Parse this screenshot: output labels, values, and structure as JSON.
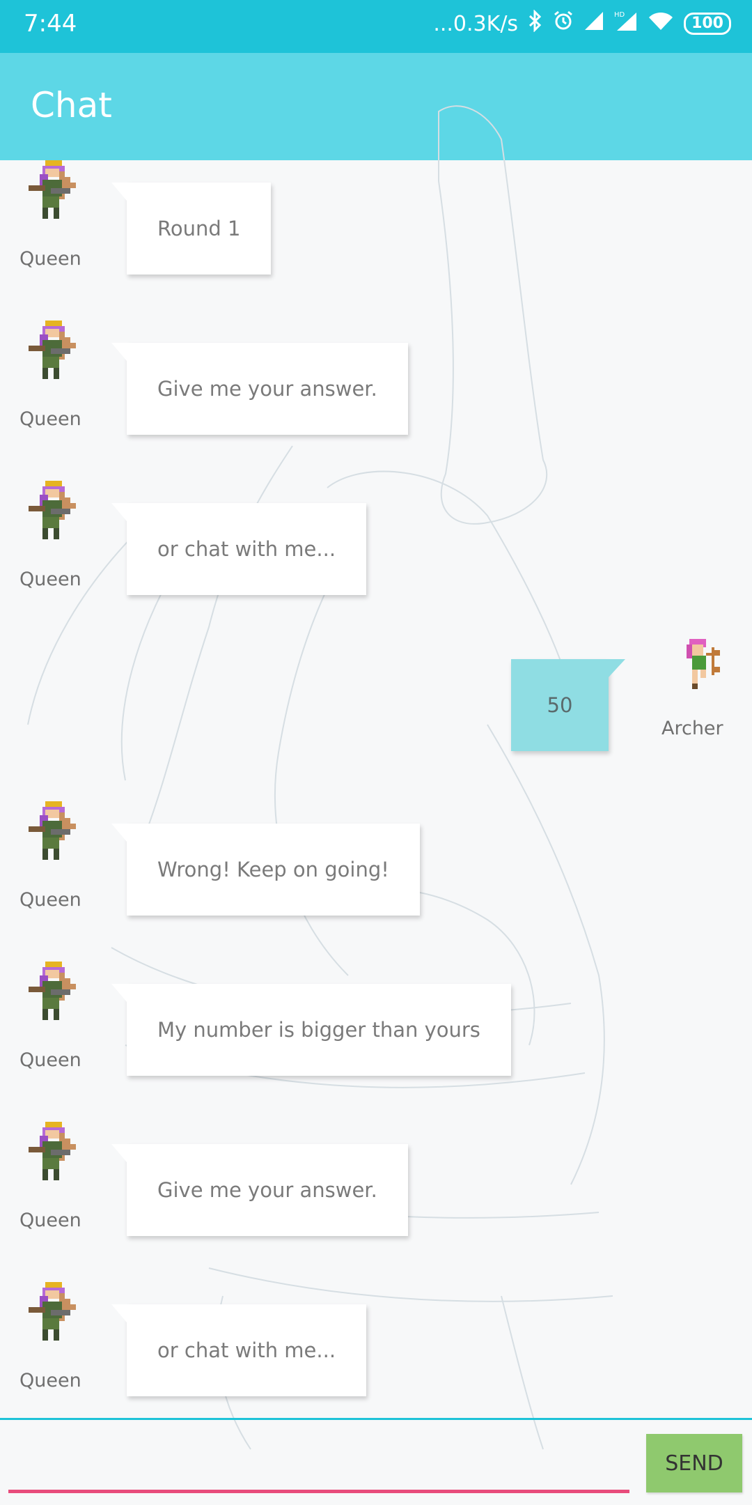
{
  "status_bar": {
    "time": "7:44",
    "network_speed": "...0.3K/s",
    "battery": "100",
    "icons": [
      "bluetooth-icon",
      "alarm-icon",
      "signal-icon",
      "hd-signal-icon",
      "wifi-icon",
      "battery-icon"
    ]
  },
  "app_bar": {
    "title": "Chat"
  },
  "colors": {
    "status_bar": "#1ec3d8",
    "app_bar": "#5dd7e6",
    "outgoing_bubble": "#8fdde3",
    "incoming_bubble": "#ffffff",
    "send_button": "#8fc96e",
    "input_underline": "#e84c7c"
  },
  "messages": [
    {
      "sender": "Queen",
      "text": "Round 1",
      "direction": "incoming",
      "avatar": "queen-avatar-icon"
    },
    {
      "sender": "Queen",
      "text": "Give me your answer.",
      "direction": "incoming",
      "avatar": "queen-avatar-icon"
    },
    {
      "sender": "Queen",
      "text": "or chat with me...",
      "direction": "incoming",
      "avatar": "queen-avatar-icon"
    },
    {
      "sender": "Archer",
      "text": "50",
      "direction": "outgoing",
      "avatar": "archer-avatar-icon"
    },
    {
      "sender": "Queen",
      "text": "Wrong! Keep on going!",
      "direction": "incoming",
      "avatar": "queen-avatar-icon"
    },
    {
      "sender": "Queen",
      "text": "My number is bigger than yours",
      "direction": "incoming",
      "avatar": "queen-avatar-icon"
    },
    {
      "sender": "Queen",
      "text": "Give me your answer.",
      "direction": "incoming",
      "avatar": "queen-avatar-icon"
    },
    {
      "sender": "Queen",
      "text": "or chat with me...",
      "direction": "incoming",
      "avatar": "queen-avatar-icon"
    }
  ],
  "composer": {
    "input_value": "",
    "send_label": "SEND"
  }
}
